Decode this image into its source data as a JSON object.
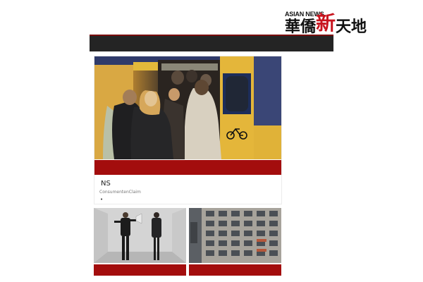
{
  "logo": {
    "en": "ASIAN NEWS",
    "cn_start": "華僑",
    "cn_accent": "新",
    "cn_end": "天地"
  },
  "featured": {
    "title": "NS",
    "source": "ConsumentenClaim",
    "bullet": "•",
    "photo_desc": "commuters-boarding-train-photo"
  },
  "cards": [
    {
      "photo": "megaphone-man-woman-photo"
    },
    {
      "photo": "apartment-building-photo"
    }
  ],
  "colors": {
    "accent_red": "#a30d0d",
    "nav_dark": "#242424",
    "logo_red": "#c8141e"
  }
}
